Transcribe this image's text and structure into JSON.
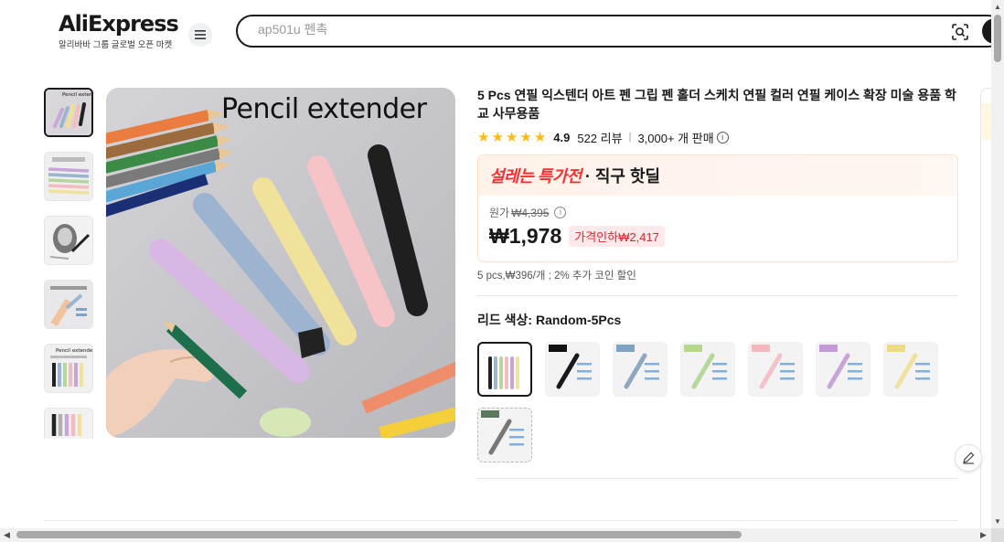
{
  "header": {
    "logo_text": "AliExpress",
    "logo_sub": "알리바바 그룹 글로벌 오픈 마켓",
    "search_placeholder": "ap501u 펜촉"
  },
  "gallery": {
    "main_caption": "Pencil extender",
    "thumbnails": [
      "thumbnail-1",
      "thumbnail-2",
      "thumbnail-3",
      "thumbnail-4",
      "thumbnail-5",
      "thumbnail-6"
    ]
  },
  "product": {
    "title": "5 Pcs 연필 익스텐더 아트 펜 그립 펜 홀더 스케치 연필 컬러 연필 케이스 확장 미술 용품 학교 사무용품",
    "rating": "4.9",
    "rating_value": 4.9,
    "reviews": "522 리뷰",
    "sold": "3,000+ 개 판매",
    "deal_brand": "설레는 특가전",
    "deal_sub": "· 직구 핫딜",
    "orig_label": "원가",
    "orig_price": "₩4,395",
    "price": "₩1,978",
    "discount": "가격인하₩2,417",
    "unit_line": "5 pcs,₩396/개 ; 2% 추가 코인 할인",
    "color_label": "리드 색상: ",
    "color_selected": "Random-5Pcs"
  },
  "swatches": [
    {
      "name": "Random-5Pcs",
      "tag": "Random-5Pcs",
      "tag_color": "#ffffff",
      "pen_color": "#888888"
    },
    {
      "name": "Black",
      "tag": "Black",
      "tag_color": "#111111",
      "pen_color": "#1a1a1a"
    },
    {
      "name": "Blue",
      "tag": "Blue",
      "tag_color": "#7fa3c4",
      "pen_color": "#8fa8c2"
    },
    {
      "name": "Green",
      "tag": "Green",
      "tag_color": "#b5d88e",
      "pen_color": "#b6d79c"
    },
    {
      "name": "Pink",
      "tag": "Pink",
      "tag_color": "#f5b5bd",
      "pen_color": "#f3c2c6"
    },
    {
      "name": "Purple",
      "tag": "Purple",
      "tag_color": "#c39ad6",
      "pen_color": "#c6a6d6"
    },
    {
      "name": "Yellow",
      "tag": "Yellow",
      "tag_color": "#eddc85",
      "pen_color": "#efe19e"
    },
    {
      "name": "Random-pencil",
      "tag": "Random pencil",
      "tag_color": "#5b7a5b",
      "pen_color": "#777777"
    }
  ],
  "colors": {
    "star": "#fdb814",
    "deal_red": "#fd2e32",
    "discount_bg": "#ffe9ea",
    "discount_text": "#e3262e"
  }
}
